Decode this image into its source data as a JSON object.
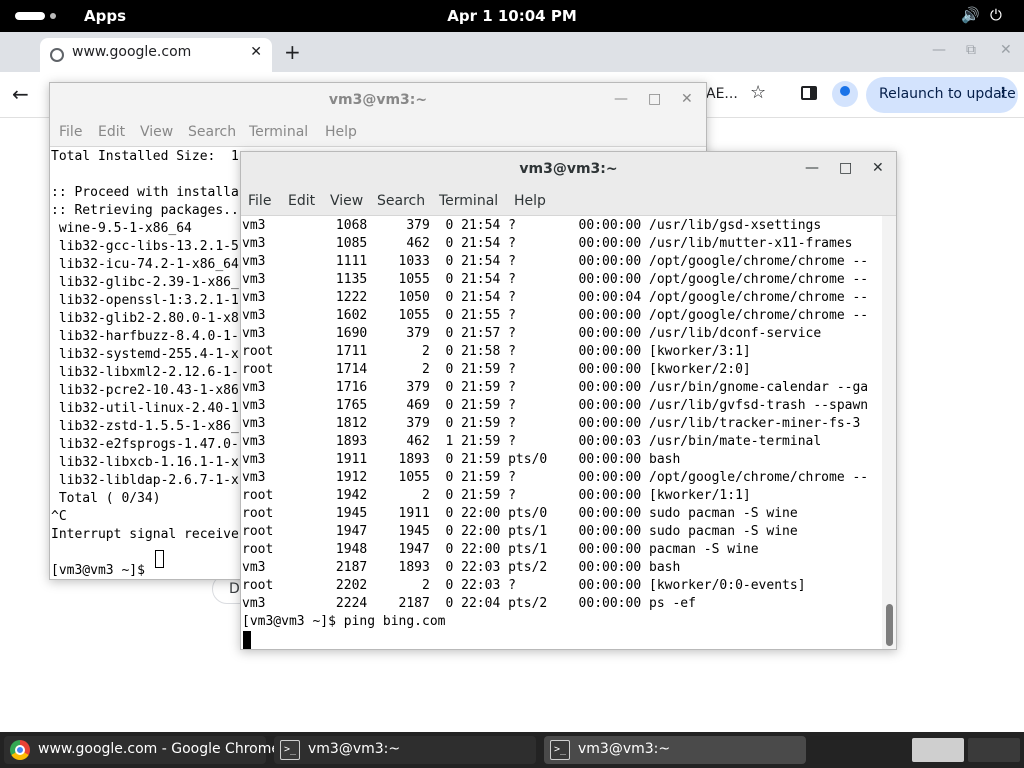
{
  "topbar": {
    "apps_label": "Apps",
    "clock": "Apr 1  10:04 PM",
    "volume_icon": "🔊",
    "power_icon": "⏻"
  },
  "chrome": {
    "tab_title": "www.google.com",
    "tab_close": "✕",
    "new_tab": "+",
    "url_fragment": "AE...",
    "relaunch_label": "Relaunch to update",
    "relaunch_more": "⋮",
    "page_button_label": "D",
    "back_icon": "←",
    "star_icon": "☆",
    "minimize": "—",
    "maximize": "⧉",
    "close": "✕"
  },
  "term1": {
    "title": "vm3@vm3:~",
    "minimize": "—",
    "maximize": "□",
    "close": "✕",
    "menu": [
      "File",
      "Edit",
      "View",
      "Search",
      "Terminal",
      "Help"
    ],
    "lines": [
      "Total Installed Size:  1",
      "",
      ":: Proceed with installa",
      ":: Retrieving packages..",
      " wine-9.5-1-x86_64",
      " lib32-gcc-libs-13.2.1-5",
      " lib32-icu-74.2-1-x86_64",
      " lib32-glibc-2.39-1-x86_",
      " lib32-openssl-1:3.2.1-1",
      " lib32-glib2-2.80.0-1-x8",
      " lib32-harfbuzz-8.4.0-1-",
      " lib32-systemd-255.4-1-x",
      " lib32-libxml2-2.12.6-1-",
      " lib32-pcre2-10.43-1-x86",
      " lib32-util-linux-2.40-1",
      " lib32-zstd-1.5.5-1-x86_",
      " lib32-e2fsprogs-1.47.0-",
      " lib32-libxcb-1.16.1-1-x",
      " lib32-libldap-2.6.7-1-x",
      " Total ( 0/34)",
      "^C",
      "Interrupt signal receive",
      "",
      "[vm3@vm3 ~]$ "
    ]
  },
  "term2": {
    "title": "vm3@vm3:~",
    "minimize": "—",
    "maximize": "□",
    "close": "✕",
    "menu": [
      "File",
      "Edit",
      "View",
      "Search",
      "Terminal",
      "Help"
    ],
    "lines": [
      "vm3         1068     379  0 21:54 ?        00:00:00 /usr/lib/gsd-xsettings",
      "vm3         1085     462  0 21:54 ?        00:00:00 /usr/lib/mutter-x11-frames",
      "vm3         1111    1033  0 21:54 ?        00:00:00 /opt/google/chrome/chrome --",
      "vm3         1135    1055  0 21:54 ?        00:00:00 /opt/google/chrome/chrome --",
      "vm3         1222    1050  0 21:54 ?        00:00:04 /opt/google/chrome/chrome --",
      "vm3         1602    1055  0 21:55 ?        00:00:00 /opt/google/chrome/chrome --",
      "vm3         1690     379  0 21:57 ?        00:00:00 /usr/lib/dconf-service",
      "root        1711       2  0 21:58 ?        00:00:00 [kworker/3:1]",
      "root        1714       2  0 21:59 ?        00:00:00 [kworker/2:0]",
      "vm3         1716     379  0 21:59 ?        00:00:00 /usr/bin/gnome-calendar --ga",
      "vm3         1765     469  0 21:59 ?        00:00:00 /usr/lib/gvfsd-trash --spawn",
      "vm3         1812     379  0 21:59 ?        00:00:00 /usr/lib/tracker-miner-fs-3",
      "vm3         1893     462  1 21:59 ?        00:00:03 /usr/bin/mate-terminal",
      "vm3         1911    1893  0 21:59 pts/0    00:00:00 bash",
      "vm3         1912    1055  0 21:59 ?        00:00:00 /opt/google/chrome/chrome --",
      "root        1942       2  0 21:59 ?        00:00:00 [kworker/1:1]",
      "root        1945    1911  0 22:00 pts/0    00:00:00 sudo pacman -S wine",
      "root        1947    1945  0 22:00 pts/1    00:00:00 sudo pacman -S wine",
      "root        1948    1947  0 22:00 pts/1    00:00:00 pacman -S wine",
      "vm3         2187    1893  0 22:03 pts/2    00:00:00 bash",
      "root        2202       2  0 22:03 ?        00:00:00 [kworker/0:0-events]",
      "vm3         2224    2187  0 22:04 pts/2    00:00:00 ps -ef",
      "[vm3@vm3 ~]$ ping bing.com"
    ]
  },
  "taskbar": {
    "items": [
      {
        "label": "www.google.com - Google Chrome"
      },
      {
        "label": "vm3@vm3:~"
      },
      {
        "label": "vm3@vm3:~"
      }
    ],
    "terminal_icon_glyph": ">_"
  }
}
